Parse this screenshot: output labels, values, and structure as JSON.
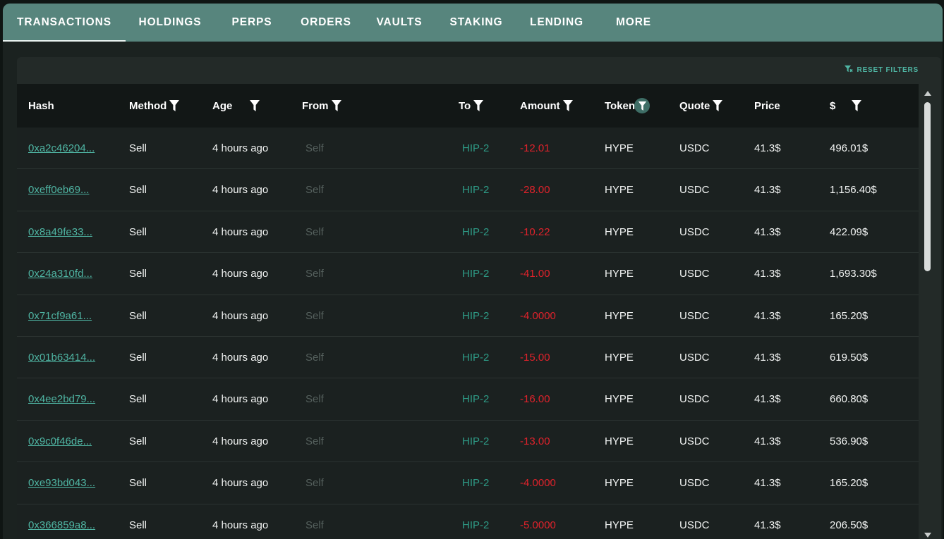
{
  "tabs": [
    {
      "label": "TRANSACTIONS",
      "active": true
    },
    {
      "label": "HOLDINGS"
    },
    {
      "label": "PERPS"
    },
    {
      "label": "ORDERS"
    },
    {
      "label": "VAULTS"
    },
    {
      "label": "STAKING"
    },
    {
      "label": "LENDING"
    },
    {
      "label": "MORE"
    }
  ],
  "reset_filters_label": "RESET FILTERS",
  "columns": {
    "hash": "Hash",
    "method": "Method",
    "age": "Age",
    "from": "From",
    "to": "To",
    "amount": "Amount",
    "token": "Token",
    "quote": "Quote",
    "price": "Price",
    "usd": "$"
  },
  "rows": [
    {
      "hash": "0xa2c46204...",
      "method": "Sell",
      "age": "4 hours ago",
      "from": "Self",
      "to": "HIP-2",
      "amount": "-12.01",
      "token": "HYPE",
      "quote": "USDC",
      "price": "41.3$",
      "usd": "496.01$"
    },
    {
      "hash": "0xeff0eb69...",
      "method": "Sell",
      "age": "4 hours ago",
      "from": "Self",
      "to": "HIP-2",
      "amount": "-28.00",
      "token": "HYPE",
      "quote": "USDC",
      "price": "41.3$",
      "usd": "1,156.40$"
    },
    {
      "hash": "0x8a49fe33...",
      "method": "Sell",
      "age": "4 hours ago",
      "from": "Self",
      "to": "HIP-2",
      "amount": "-10.22",
      "token": "HYPE",
      "quote": "USDC",
      "price": "41.3$",
      "usd": "422.09$"
    },
    {
      "hash": "0x24a310fd...",
      "method": "Sell",
      "age": "4 hours ago",
      "from": "Self",
      "to": "HIP-2",
      "amount": "-41.00",
      "token": "HYPE",
      "quote": "USDC",
      "price": "41.3$",
      "usd": "1,693.30$"
    },
    {
      "hash": "0x71cf9a61...",
      "method": "Sell",
      "age": "4 hours ago",
      "from": "Self",
      "to": "HIP-2",
      "amount": "-4.0000",
      "token": "HYPE",
      "quote": "USDC",
      "price": "41.3$",
      "usd": "165.20$"
    },
    {
      "hash": "0x01b63414...",
      "method": "Sell",
      "age": "4 hours ago",
      "from": "Self",
      "to": "HIP-2",
      "amount": "-15.00",
      "token": "HYPE",
      "quote": "USDC",
      "price": "41.3$",
      "usd": "619.50$"
    },
    {
      "hash": "0x4ee2bd79...",
      "method": "Sell",
      "age": "4 hours ago",
      "from": "Self",
      "to": "HIP-2",
      "amount": "-16.00",
      "token": "HYPE",
      "quote": "USDC",
      "price": "41.3$",
      "usd": "660.80$"
    },
    {
      "hash": "0x9c0f46de...",
      "method": "Sell",
      "age": "4 hours ago",
      "from": "Self",
      "to": "HIP-2",
      "amount": "-13.00",
      "token": "HYPE",
      "quote": "USDC",
      "price": "41.3$",
      "usd": "536.90$"
    },
    {
      "hash": "0xe93bd043...",
      "method": "Sell",
      "age": "4 hours ago",
      "from": "Self",
      "to": "HIP-2",
      "amount": "-4.0000",
      "token": "HYPE",
      "quote": "USDC",
      "price": "41.3$",
      "usd": "165.20$"
    },
    {
      "hash": "0x366859a8...",
      "method": "Sell",
      "age": "4 hours ago",
      "from": "Self",
      "to": "HIP-2",
      "amount": "-5.0000",
      "token": "HYPE",
      "quote": "USDC",
      "price": "41.3$",
      "usd": "206.50$"
    }
  ],
  "colors": {
    "tab_bar": "#57857d",
    "accent_teal": "#4fb5a3",
    "negative_red": "#e0222b",
    "panel": "#232a28",
    "table_header": "#121716"
  },
  "icons": {
    "filter": "filter-icon",
    "reset": "filter-reset-icon",
    "scroll_up": "caret-up-icon",
    "scroll_down": "caret-down-icon"
  }
}
